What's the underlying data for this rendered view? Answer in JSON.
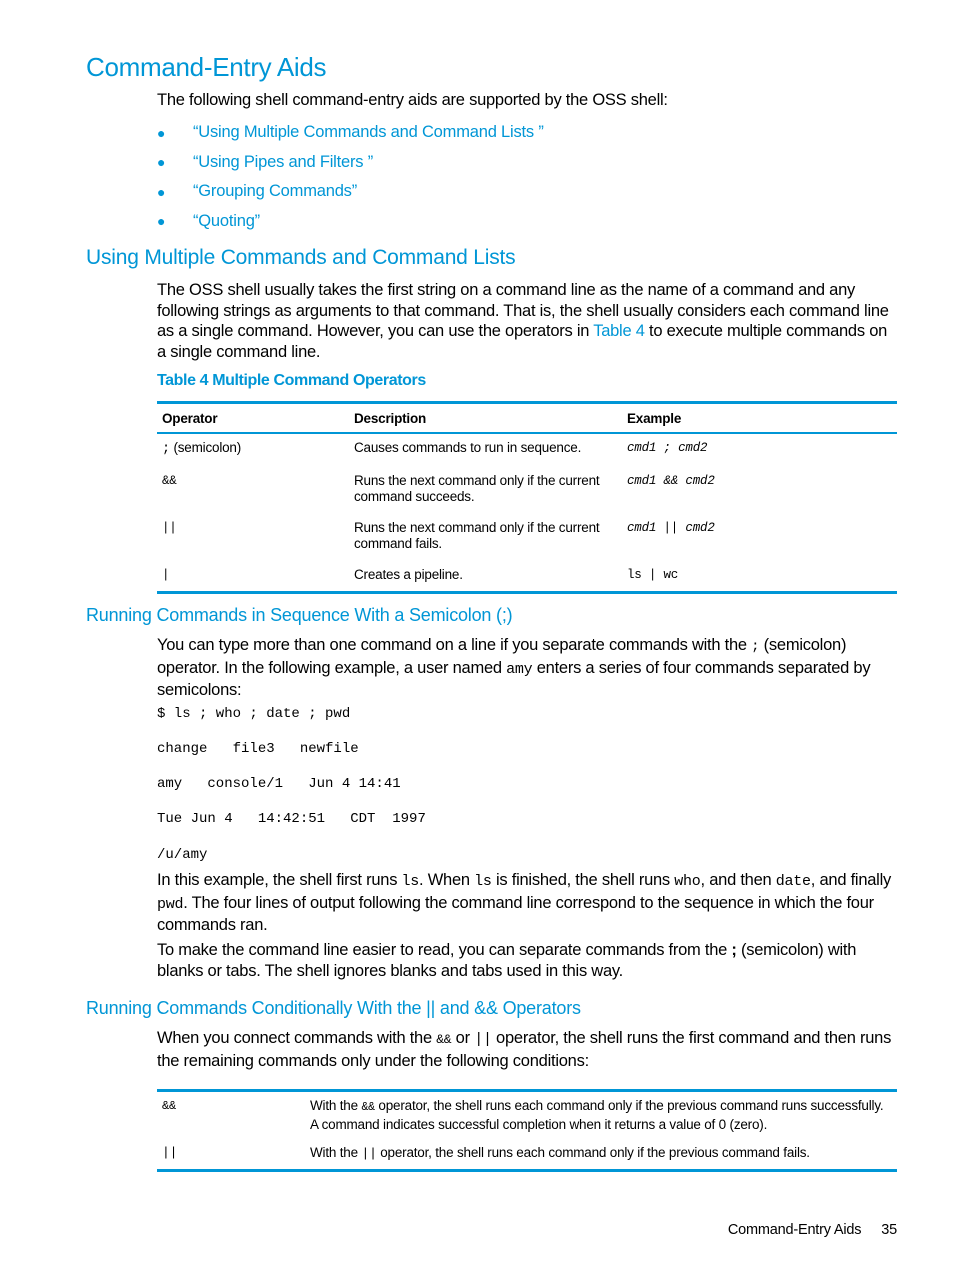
{
  "page_title": "Command-Entry Aids",
  "intro": "The following shell command-entry aids are supported by the OSS shell:",
  "links": [
    "“Using Multiple Commands and Command Lists ”",
    "“Using Pipes and Filters ”",
    "“Grouping Commands”",
    "“Quoting”"
  ],
  "section1": {
    "heading": "Using Multiple Commands and Command Lists",
    "para_before_link": "The OSS shell usually takes the first string on a command line as the name of a command and any following strings as arguments to that command. That is, the shell usually considers each command line as a single command. However, you can use the operators in ",
    "para_link": "Table 4",
    "para_after_link": " to execute multiple commands on a single command line."
  },
  "table4": {
    "caption": "Table 4 Multiple Command Operators",
    "headers": [
      "Operator",
      "Description",
      "Example"
    ],
    "rows": [
      {
        "operator": ";",
        "operator_suffix": " (semicolon)",
        "description": "Causes commands to run in sequence.",
        "example": "cmd1 ; cmd2"
      },
      {
        "operator": "&&",
        "operator_suffix": "",
        "description": "Runs the next command only if the current command succeeds.",
        "example": "cmd1 && cmd2"
      },
      {
        "operator": "||",
        "operator_suffix": "",
        "description": "Runs the next command only if the current command fails.",
        "example": "cmd1 || cmd2"
      },
      {
        "operator": "|",
        "operator_suffix": "",
        "description": "Creates a pipeline.",
        "example": "ls | wc"
      }
    ]
  },
  "section2": {
    "heading": "Running Commands in Sequence With a Semicolon (;)",
    "p1_a": "You can type more than one command on a line if you separate commands with the ",
    "p1_code1": ";",
    "p1_b": " (semicolon) operator. In the following example, a user named ",
    "p1_code2": "amy",
    "p1_c": " enters a series of four commands separated by semicolons:",
    "code_lines": [
      "$ ls ; who ; date ; pwd",
      "change   file3   newfile",
      "amy   console/1   Jun 4 14:41",
      "Tue Jun 4   14:42:51   CDT  1997",
      "/u/amy"
    ],
    "p2_a": "In this example, the shell first runs ",
    "p2_c1": "ls",
    "p2_b": ". When ",
    "p2_c2": "ls",
    "p2_c": " is finished, the shell runs ",
    "p2_c3": "who",
    "p2_d": ", and then ",
    "p2_c4": "date",
    "p2_e": ", and finally ",
    "p2_c5": "pwd",
    "p2_f": ". The four lines of output following the command line correspond to the sequence in which the four commands ran.",
    "p3_a": "To make the command line easier to read, you can separate commands from the ",
    "p3_b": ";",
    "p3_c": " (semicolon) with blanks or tabs. The shell ignores blanks and tabs used in this way."
  },
  "section3": {
    "heading": "Running Commands Conditionally With the || and && Operators",
    "p1_a": "When you connect commands with the ",
    "p1_c1": "&&",
    "p1_b": " or ",
    "p1_c2": "||",
    "p1_c": " operator, the shell runs the first command and then runs the remaining commands only under the following conditions:",
    "rows": [
      {
        "operator": "&&",
        "desc_a": "With the ",
        "desc_code": "&&",
        "desc_b": " operator, the shell runs each command only if the previous command runs successfully. A command indicates successful completion when it returns a value of 0 (zero)."
      },
      {
        "operator": "||",
        "desc_a": "With the ",
        "desc_code": "||",
        "desc_b": " operator, the shell runs each command only if the previous command fails."
      }
    ]
  },
  "footer": {
    "section": "Command-Entry Aids",
    "page_number": "35"
  }
}
